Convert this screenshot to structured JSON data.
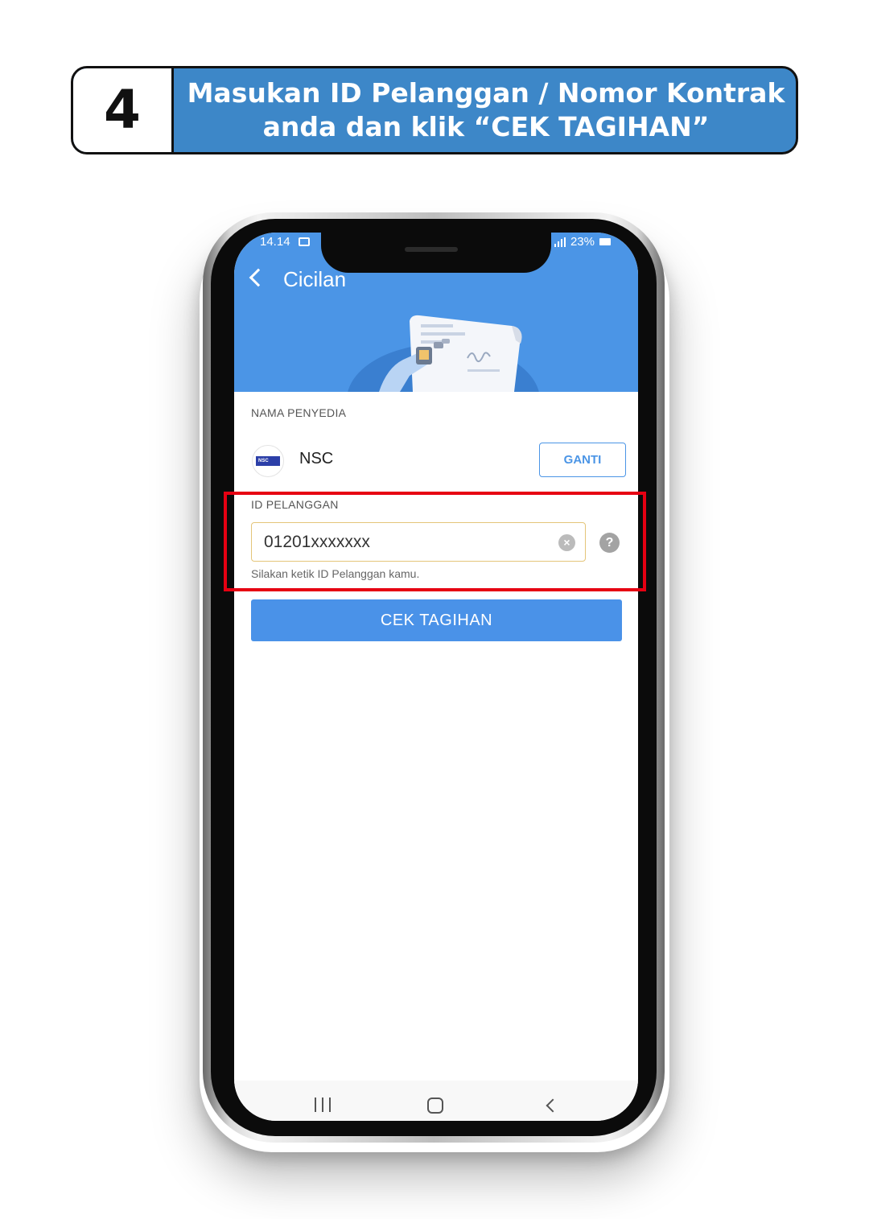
{
  "banner": {
    "step_number": "4",
    "title_line1": "Masukan ID Pelanggan / Nomor Kontrak",
    "title_line2": "anda dan klik “CEK TAGIHAN”",
    "color": "#3d87c8"
  },
  "status_bar": {
    "time": "14.14",
    "battery": "23%"
  },
  "app": {
    "header_title": "Cicilan",
    "header_color": "#4b95e6",
    "provider_section_label": "NAMA PENYEDIA",
    "provider_logo_text": "NSC",
    "provider_name": "NSC",
    "change_button_label": "GANTI",
    "customer_id_label": "ID PELANGGAN",
    "customer_id_value": "01201xxxxxxx",
    "customer_id_hint": "Silakan ketik ID Pelanggan kamu.",
    "check_bill_button_label": "CEK TAGIHAN",
    "button_color": "#4a92e8"
  },
  "highlight_color": "#e60012"
}
